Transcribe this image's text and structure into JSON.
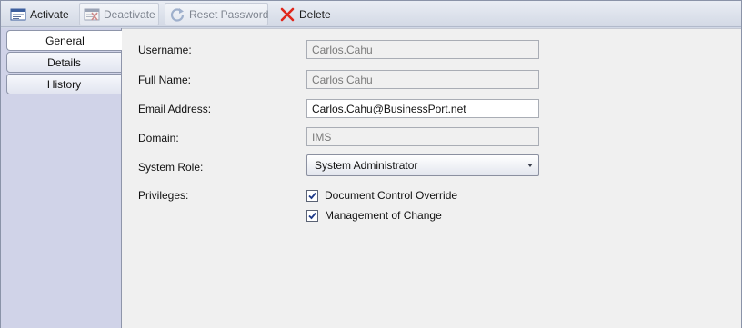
{
  "toolbar": {
    "activate": {
      "label": "Activate",
      "icon": "activate-icon"
    },
    "deactivate": {
      "label": "Deactivate",
      "icon": "deactivate-icon"
    },
    "reset_password": {
      "label": "Reset Password",
      "icon": "refresh-icon"
    },
    "delete": {
      "label": "Delete",
      "icon": "delete-x-icon",
      "icon_color": "#e0261b"
    }
  },
  "tabs": [
    {
      "label": "General",
      "active": true
    },
    {
      "label": "Details",
      "active": false
    },
    {
      "label": "History",
      "active": false
    }
  ],
  "form": {
    "username": {
      "label": "Username:",
      "value": "Carlos.Cahu"
    },
    "full_name": {
      "label": "Full Name:",
      "value": "Carlos Cahu"
    },
    "email": {
      "label": "Email Address:",
      "value": "Carlos.Cahu@BusinessPort.net"
    },
    "domain": {
      "label": "Domain:",
      "value": "IMS"
    },
    "system_role": {
      "label": "System Role:",
      "value": "System Administrator"
    },
    "privileges": {
      "label": "Privileges:",
      "items": [
        {
          "label": "Document Control Override",
          "checked": true
        },
        {
          "label": "Management of Change",
          "checked": true
        }
      ]
    }
  }
}
